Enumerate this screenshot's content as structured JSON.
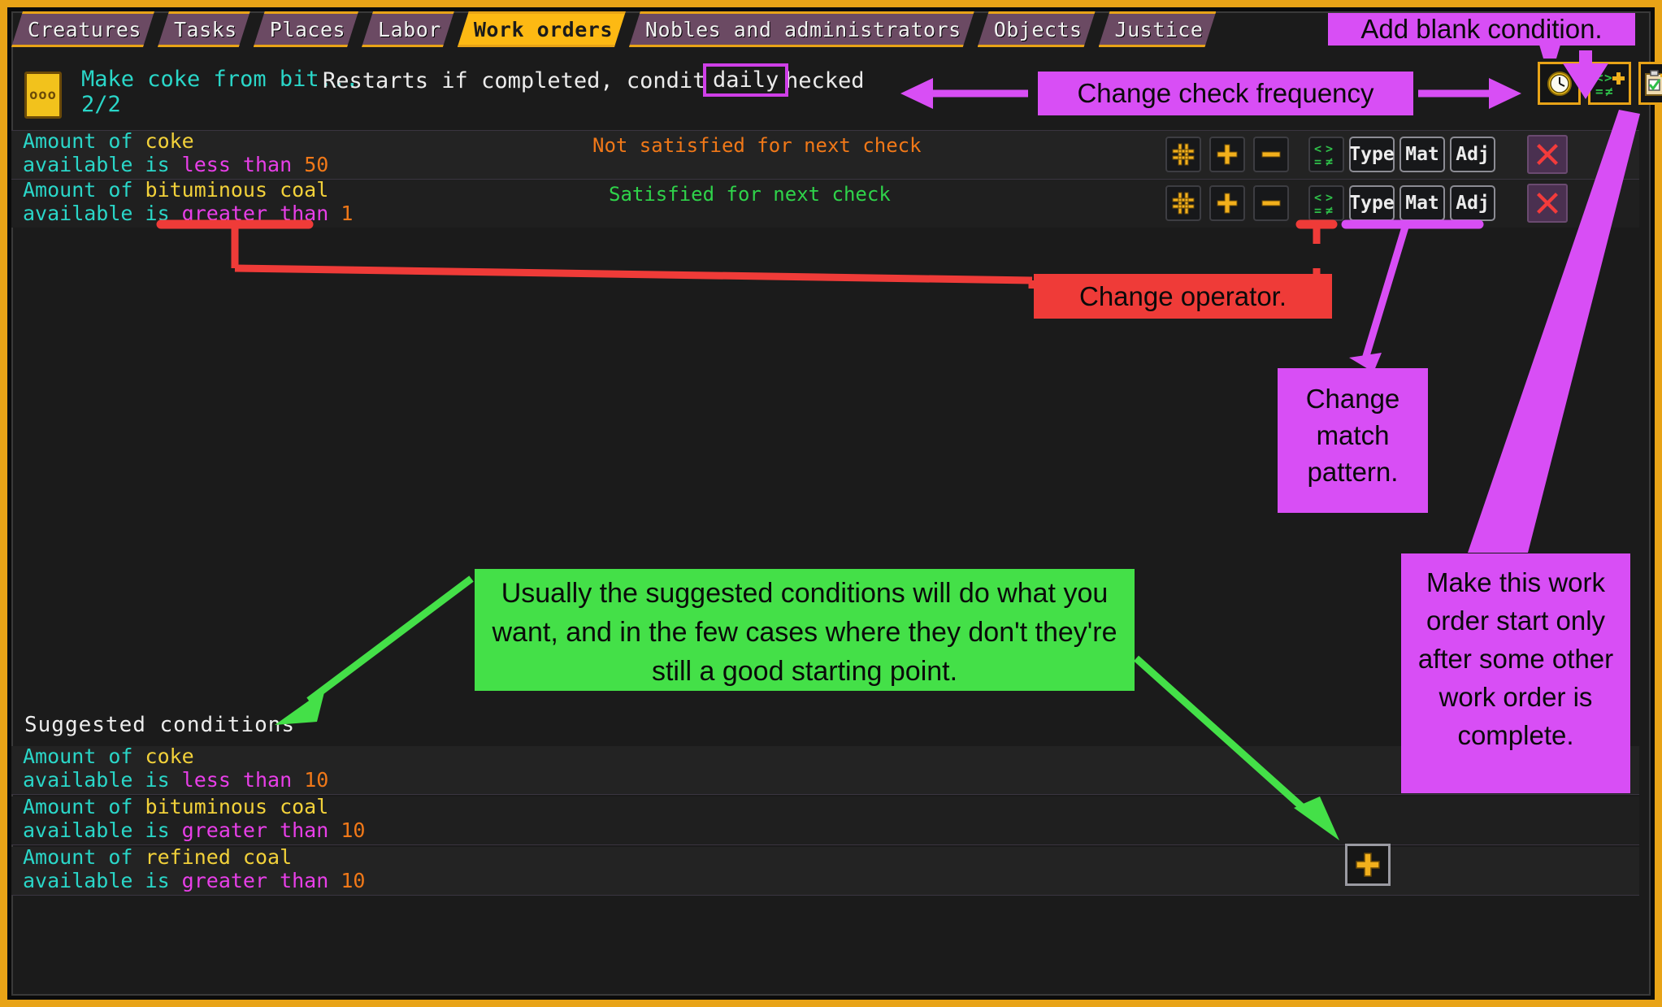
{
  "tabs": [
    {
      "label": "Creatures",
      "selected": false
    },
    {
      "label": "Tasks",
      "selected": false
    },
    {
      "label": "Places",
      "selected": false
    },
    {
      "label": "Labor",
      "selected": false
    },
    {
      "label": "Work orders",
      "selected": true
    },
    {
      "label": "Nobles and administrators",
      "selected": false
    },
    {
      "label": "Objects",
      "selected": false
    },
    {
      "label": "Justice",
      "selected": false
    }
  ],
  "order": {
    "icon_glyph": "ooo",
    "title": "Make coke from bit...",
    "count": "2/2",
    "restart_text": "Restarts if completed, conditions checked",
    "frequency": "daily",
    "buttons": [
      {
        "name": "clock-icon",
        "label": ""
      },
      {
        "name": "comparison-add-icon",
        "label": ""
      },
      {
        "name": "clipboard-add-icon",
        "label": ""
      }
    ]
  },
  "conditions": [
    {
      "line1_prefix": "Amount of ",
      "material": "coke",
      "line2_prefix": "available is ",
      "operator": "less than",
      "value": "50",
      "status": "Not satisfied for next check",
      "status_state": "unsatisfied",
      "buttons": [
        "#",
        "+",
        "−"
      ],
      "tag_buttons": [
        "Type",
        "Mat",
        "Adj"
      ],
      "delete_label": "✕"
    },
    {
      "line1_prefix": "Amount of ",
      "material": "bituminous coal",
      "line2_prefix": "available is ",
      "operator": "greater than",
      "value": "1",
      "status": "Satisfied for next check",
      "status_state": "satisfied",
      "buttons": [
        "#",
        "+",
        "−"
      ],
      "tag_buttons": [
        "Type",
        "Mat",
        "Adj"
      ],
      "delete_label": "✕"
    }
  ],
  "suggested": {
    "title": "Suggested conditions",
    "add_label": "+",
    "rows": [
      {
        "line1_prefix": "Amount of ",
        "material": "coke",
        "line2_prefix": "available is ",
        "operator": "less than",
        "value": "10"
      },
      {
        "line1_prefix": "Amount of ",
        "material": "bituminous coal",
        "line2_prefix": "available is ",
        "operator": "greater than",
        "value": "10"
      },
      {
        "line1_prefix": "Amount of ",
        "material": "refined coal",
        "line2_prefix": "available is ",
        "operator": "greater than",
        "value": "10"
      }
    ]
  },
  "annotations": {
    "add_blank_condition": "Add blank condition.",
    "change_check_frequency": "Change  check frequency",
    "change_operator": "Change operator.",
    "change_match_pattern": "Change\nmatch\npattern.",
    "make_start_after": "Make this work order start only after some other work order is complete.",
    "suggested_note": "Usually the suggested conditions will do what you want, and in the few cases where they don't they're still a good starting point."
  },
  "colors": {
    "frame": "#e8a317",
    "tab_selected": "#fdb913",
    "tab_normal": "#6b4a63",
    "cyan": "#2ad6c8",
    "yellow": "#f2d13a",
    "magenta": "#e83fe8",
    "orange": "#f07818",
    "green": "#2fd34a",
    "annotation_magenta": "#d84ef5",
    "annotation_red": "#ef3b38",
    "annotation_green": "#44e048"
  }
}
